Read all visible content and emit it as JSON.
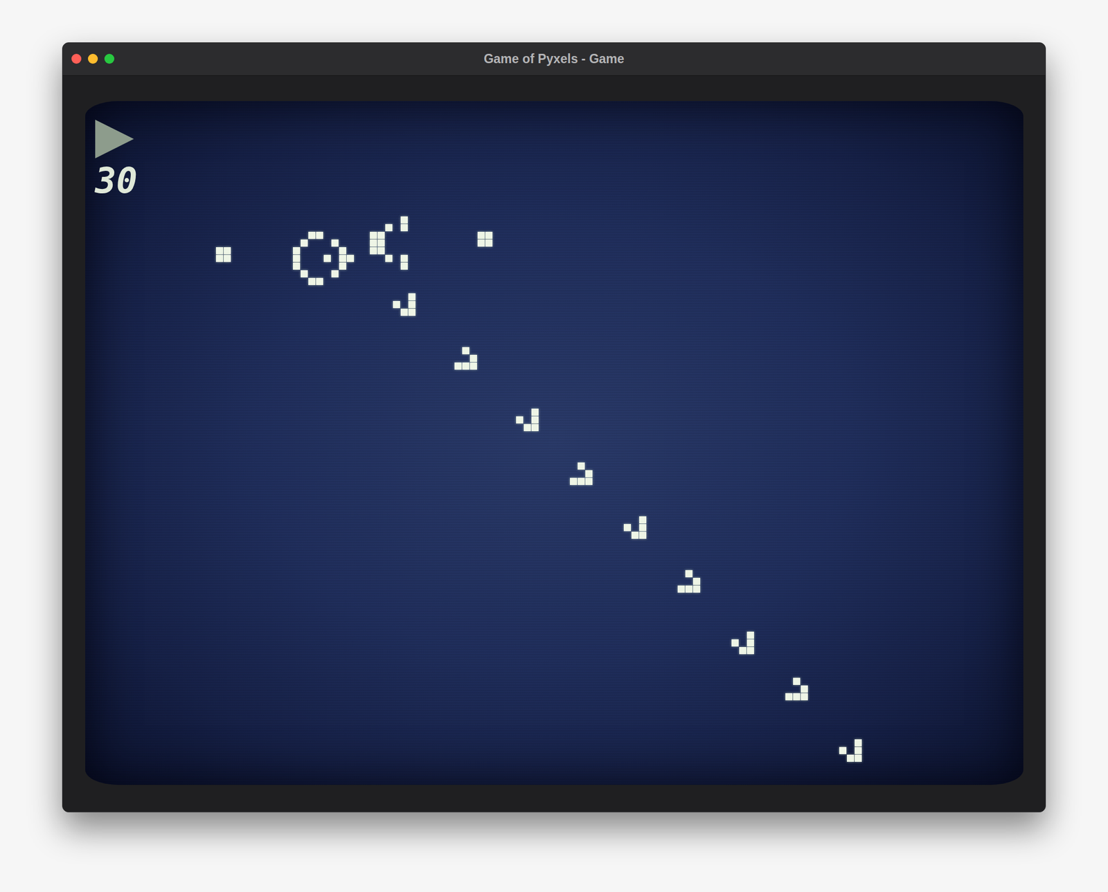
{
  "window": {
    "title": "Game of Pyxels - Game"
  },
  "hud": {
    "state_icon": "▶",
    "generation": "30"
  },
  "live_cells": [
    [
      17,
      19
    ],
    [
      18,
      19
    ],
    [
      17,
      20
    ],
    [
      18,
      20
    ],
    [
      27,
      19
    ],
    [
      27,
      20
    ],
    [
      27,
      21
    ],
    [
      28,
      18
    ],
    [
      28,
      22
    ],
    [
      29,
      17
    ],
    [
      29,
      23
    ],
    [
      30,
      17
    ],
    [
      30,
      23
    ],
    [
      31,
      20
    ],
    [
      32,
      18
    ],
    [
      32,
      22
    ],
    [
      33,
      19
    ],
    [
      33,
      20
    ],
    [
      33,
      21
    ],
    [
      34,
      20
    ],
    [
      37,
      17
    ],
    [
      37,
      18
    ],
    [
      37,
      19
    ],
    [
      38,
      17
    ],
    [
      38,
      18
    ],
    [
      38,
      19
    ],
    [
      39,
      16
    ],
    [
      39,
      20
    ],
    [
      41,
      15
    ],
    [
      41,
      16
    ],
    [
      41,
      20
    ],
    [
      41,
      21
    ],
    [
      51,
      17
    ],
    [
      52,
      17
    ],
    [
      51,
      18
    ],
    [
      52,
      18
    ],
    [
      42,
      25
    ],
    [
      40,
      26
    ],
    [
      42,
      26
    ],
    [
      41,
      27
    ],
    [
      42,
      27
    ],
    [
      49,
      32
    ],
    [
      50,
      33
    ],
    [
      48,
      34
    ],
    [
      49,
      34
    ],
    [
      50,
      34
    ],
    [
      58,
      40
    ],
    [
      56,
      41
    ],
    [
      58,
      41
    ],
    [
      57,
      42
    ],
    [
      58,
      42
    ],
    [
      64,
      47
    ],
    [
      65,
      48
    ],
    [
      63,
      49
    ],
    [
      64,
      49
    ],
    [
      65,
      49
    ],
    [
      72,
      54
    ],
    [
      70,
      55
    ],
    [
      72,
      55
    ],
    [
      71,
      56
    ],
    [
      72,
      56
    ],
    [
      78,
      61
    ],
    [
      79,
      62
    ],
    [
      77,
      63
    ],
    [
      78,
      63
    ],
    [
      79,
      63
    ],
    [
      86,
      69
    ],
    [
      84,
      70
    ],
    [
      86,
      70
    ],
    [
      85,
      71
    ],
    [
      86,
      71
    ],
    [
      92,
      75
    ],
    [
      93,
      76
    ],
    [
      91,
      77
    ],
    [
      92,
      77
    ],
    [
      93,
      77
    ],
    [
      100,
      83
    ],
    [
      98,
      84
    ],
    [
      100,
      84
    ],
    [
      99,
      85
    ],
    [
      100,
      85
    ]
  ]
}
